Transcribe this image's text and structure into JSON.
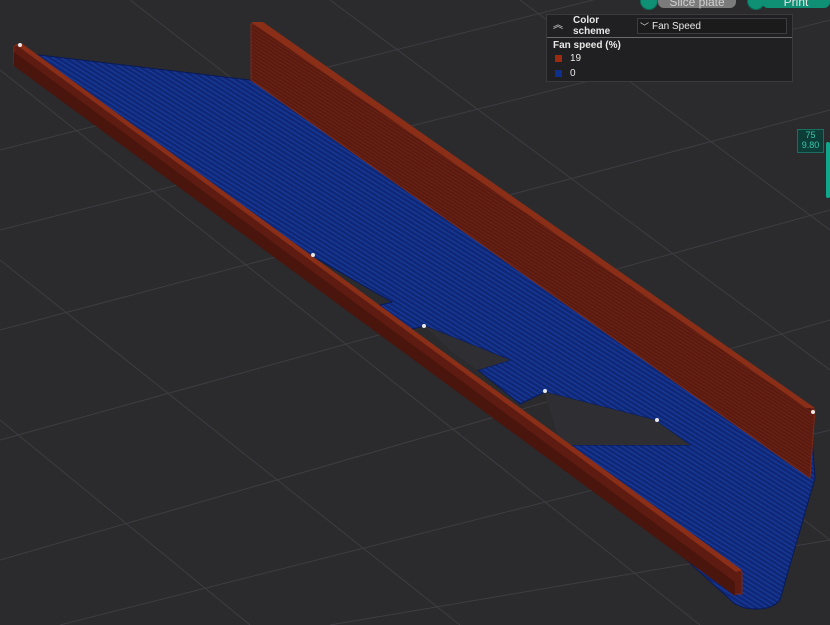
{
  "toolbar": {
    "slice_label": "Slice plate",
    "print_label": "Print"
  },
  "legend": {
    "color_scheme_label": "Color scheme",
    "color_scheme_value": "Fan Speed",
    "title": "Fan speed (%)",
    "items": [
      {
        "label": "19",
        "color": "#9b2a10"
      },
      {
        "label": "0",
        "color": "#0e2f8c"
      }
    ]
  },
  "layer_slider": {
    "layer": "75",
    "height": "9.80"
  },
  "colors": {
    "background": "#2b2b2e",
    "grid": "#3a3a3e",
    "wall": "#5a1a10",
    "infill": "#0f2570",
    "accent": "#0f8f73"
  }
}
